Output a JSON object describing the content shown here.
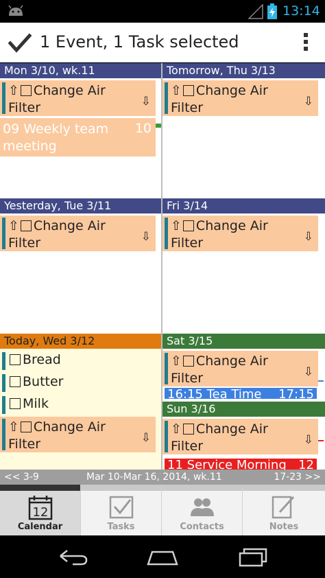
{
  "status_bar": {
    "time": "13:14"
  },
  "action_bar": {
    "title": "1 Event, 1 Task selected"
  },
  "days": {
    "mon": {
      "header": "Mon 3/10, wk.11"
    },
    "thu": {
      "header": "Tomorrow, Thu 3/13"
    },
    "tue": {
      "header": "Yesterday, Tue 3/11"
    },
    "fri": {
      "header": "Fri 3/14"
    },
    "wed": {
      "header": "Today, Wed 3/12"
    },
    "sat": {
      "header": "Sat 3/15"
    },
    "sun": {
      "header": "Sun 3/16"
    }
  },
  "task": {
    "line1": "Change Air",
    "line2": "Filter"
  },
  "event_weekly": {
    "start": "09",
    "title_line1": "Weekly team",
    "title_line2": "meeting",
    "end": "10"
  },
  "shopping": [
    "Bread",
    "Butter",
    "Milk"
  ],
  "event_tea": {
    "start": "16:15",
    "title": "Tea Time",
    "end": "17:15"
  },
  "event_service": {
    "start": "11",
    "title": "Service Morning",
    "end": "12"
  },
  "range_bar": {
    "prev": "<< 3-9",
    "current": "Mar 10-Mar 16, 2014, wk.11",
    "next": "17-23 >>"
  },
  "tabs": [
    {
      "label": "Calendar",
      "icon_day": "12"
    },
    {
      "label": "Tasks"
    },
    {
      "label": "Contacts"
    },
    {
      "label": "Notes"
    }
  ],
  "colors": {
    "header_blue": "#414a87",
    "header_today": "#e07b10",
    "header_weekend": "#3c7a3a",
    "task_bg": "#fbc99e",
    "task_bar": "#1f7d90",
    "today_bg": "#fffbdc",
    "tea_bg": "#3d7fe0",
    "service_bg": "#e81f1f"
  }
}
